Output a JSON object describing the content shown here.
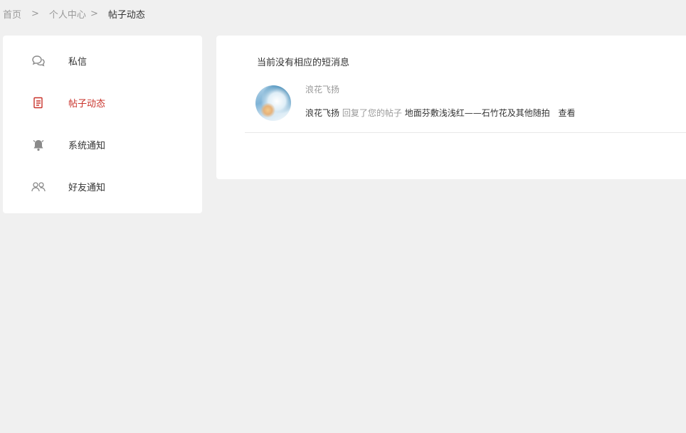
{
  "breadcrumb": {
    "home": "首页",
    "sep1": ">",
    "center": "个人中心",
    "sep2": ">",
    "current": "帖子动态"
  },
  "sidebar": {
    "items": [
      {
        "label": "私信",
        "icon": "chat-bubbles-icon",
        "active": false
      },
      {
        "label": "帖子动态",
        "icon": "post-document-icon",
        "active": true
      },
      {
        "label": "系统通知",
        "icon": "bell-icon",
        "active": false
      },
      {
        "label": "好友通知",
        "icon": "friends-icon",
        "active": false
      }
    ]
  },
  "main": {
    "empty_message": "当前没有相应的短消息",
    "messages": [
      {
        "username": "浪花飞扬",
        "actor": "浪花飞扬",
        "action": "回复了您的帖子",
        "post_title": "地面芬敷浅浅红——石竹花及其他随拍",
        "view_label": "查看"
      }
    ]
  },
  "colors": {
    "accent": "#c9322a",
    "muted": "#999999",
    "background": "#f0f0f0"
  }
}
